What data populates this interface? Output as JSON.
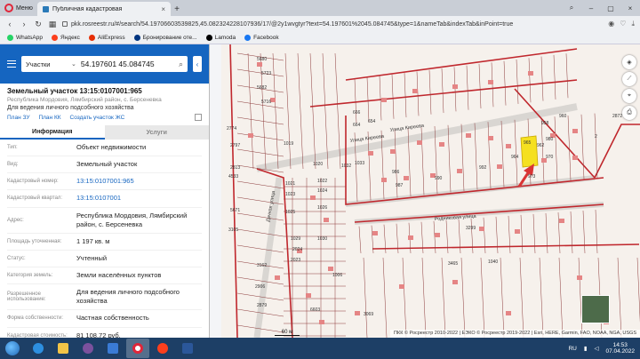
{
  "browser": {
    "menu_label": "Меню",
    "tab_title": "Публичная кадастровая",
    "url": "pkk.rosreestr.ru/#/search/54.19706603539825,45.08232422810793​6/17/@2y1wvgtyr?text=54.197601%2045.084745&type=1&nameTab&indexTab&inPoint=true",
    "bookmarks": [
      {
        "label": "WhatsApp",
        "icon": "whatsapp-icon",
        "color": "#25d366"
      },
      {
        "label": "Яндекс",
        "icon": "yandex-icon",
        "color": "#fc3f1d"
      },
      {
        "label": "AliExpress",
        "icon": "aliexpress-icon",
        "color": "#e62e04"
      },
      {
        "label": "Бронирование оте...",
        "icon": "booking-icon",
        "color": "#003580"
      },
      {
        "label": "Lamoda",
        "icon": "lamoda-icon",
        "color": "#000000"
      },
      {
        "label": "Facebook",
        "icon": "facebook-icon",
        "color": "#1877f2"
      }
    ]
  },
  "search": {
    "type": "Участки",
    "query": "54.197601 45.084745"
  },
  "object": {
    "title": "Земельный участок 13:15:0107001:965",
    "address_short": "Республика Мордовия, Лямбирский район, с. Берсеневка",
    "use": "Для ведения личного подсобного хозяйства",
    "links": [
      "План ЗУ",
      "План КК",
      "Создать участок ЖС"
    ]
  },
  "tabs": {
    "info": "Информация",
    "services": "Услуги"
  },
  "rows": [
    {
      "k": "Тип:",
      "v": "Объект недвижимости"
    },
    {
      "k": "Вид:",
      "v": "Земельный участок"
    },
    {
      "k": "Кадастровый номер:",
      "v": "13:15:0107001:965",
      "link": true
    },
    {
      "k": "Кадастровый квартал:",
      "v": "13:15:0107001",
      "link": true
    },
    {
      "k": "Адрес:",
      "v": "Республика Мордовия, Лямбирский район, с. Берсеневка"
    },
    {
      "k": "Площадь уточненная:",
      "v": "1 197 кв. м"
    },
    {
      "k": "Статус:",
      "v": "Учтенный"
    },
    {
      "k": "Категория земель:",
      "v": "Земли населённых пунктов"
    },
    {
      "k": "Разрешенное использование:",
      "v": "Для ведения личного подсобного хозяйства"
    },
    {
      "k": "Форма собственности:",
      "v": "Частная собственность"
    },
    {
      "k": "Кадастровая стоимость:",
      "v": "81 108,72 руб."
    }
  ],
  "map": {
    "streets": [
      "Улица Киреева",
      "Дачная улица",
      "Родниковая улица"
    ],
    "parcels": [
      "5680",
      "5723",
      "5682",
      "5716",
      "666",
      "664",
      "654",
      "2774",
      "2797",
      "1019",
      "1020",
      "2813",
      "1021",
      "1022",
      "4533",
      "5671",
      "1023",
      "1024",
      "3105",
      "1025",
      "1026",
      "1029",
      "1030",
      "2024",
      "2023",
      "3162",
      "2906",
      "2879",
      "6603",
      "3069",
      "1006",
      "986",
      "987",
      "990",
      "992",
      "965",
      "973",
      "964",
      "980",
      "970",
      "958",
      "2872",
      "960",
      "1032",
      "1033",
      "3299",
      "3465",
      "1040",
      "2",
      "962"
    ],
    "scale": "60 м",
    "attribution": "ПКК © Росреестр 2010-2022 | ЕЭКО © Росреестр 2019-2022 | Esri, HERE, Garmin, FAO, NOAA, NGA, USGS"
  },
  "taskbar": {
    "lang": "RU",
    "time": "14:53",
    "date": "07.04.2022"
  },
  "colors": {
    "accent": "#1565c0",
    "highlight": "#f5e020",
    "boundary": "#c0272d",
    "arrow": "#d93434"
  }
}
